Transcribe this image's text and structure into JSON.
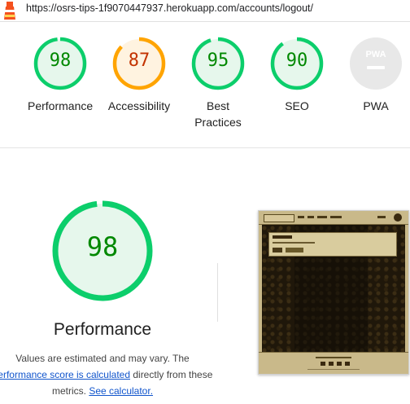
{
  "browser": {
    "url": "https://osrs-tips-1f9070447937.herokuapp.com/accounts/logout/"
  },
  "colors": {
    "pass": "#0cce6b",
    "pass_text": "#008800",
    "pass_bg": "#e6f7ec",
    "average": "#ffa400",
    "average_text": "#c33300",
    "average_bg": "#fff3e0",
    "pwa_bg": "#e8e8e8"
  },
  "summary": {
    "categories": [
      {
        "score": "98",
        "label": "Performance",
        "value": 0.98,
        "status": "pass"
      },
      {
        "score": "87",
        "label": "Accessibility",
        "value": 0.87,
        "status": "average"
      },
      {
        "score": "95",
        "label": "Best",
        "label2": "Practices",
        "value": 0.95,
        "status": "pass"
      },
      {
        "score": "90",
        "label": "SEO",
        "value": 0.9,
        "status": "pass"
      },
      {
        "score": "",
        "label": "PWA",
        "badge": "PWA",
        "status": "na"
      }
    ]
  },
  "performance": {
    "score": "98",
    "value": 0.98,
    "title": "Performance",
    "note_line1": "Values are estimated and may vary. The",
    "note_link1": "performance score is calculated",
    "note_line2_suffix": " directly from these",
    "note_line3_prefix": "metrics. ",
    "note_link2": "See calculator."
  },
  "final_screenshot": {
    "icon": "page-screenshot-thumbnail"
  }
}
